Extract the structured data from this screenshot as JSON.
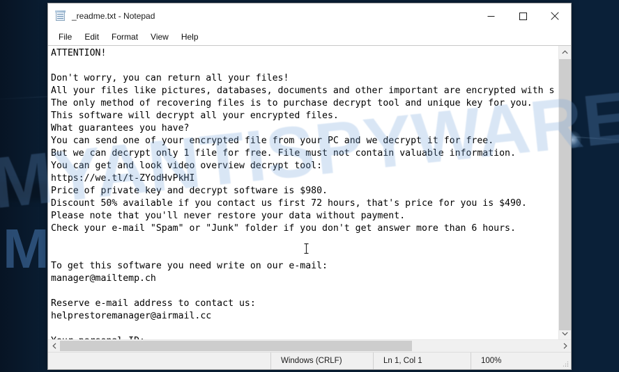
{
  "desktop": {
    "watermark_letter": "M",
    "overlay_watermark": "MYANTISPYWARE.COM",
    "bg_dark": "#0a2038",
    "bg_light": "#0d3b6e"
  },
  "window": {
    "title": "_readme.txt - Notepad",
    "icon": "notepad-icon",
    "controls": {
      "minimize": "minimize-icon",
      "maximize": "maximize-icon",
      "close": "close-icon"
    }
  },
  "menubar": {
    "items": [
      {
        "label": "File"
      },
      {
        "label": "Edit"
      },
      {
        "label": "Format"
      },
      {
        "label": "View"
      },
      {
        "label": "Help"
      }
    ]
  },
  "document": {
    "filename": "_readme.txt",
    "lines": [
      "ATTENTION!",
      "",
      "Don't worry, you can return all your files!",
      "All your files like pictures, databases, documents and other important are encrypted with s",
      "The only method of recovering files is to purchase decrypt tool and unique key for you.",
      "This software will decrypt all your encrypted files.",
      "What guarantees you have?",
      "You can send one of your encrypted file from your PC and we decrypt it for free.",
      "But we can decrypt only 1 file for free. File must not contain valuable information.",
      "You can get and look video overview decrypt tool:",
      "https://we.tl/t-ZYodHvPkHI",
      "Price of private key and decrypt software is $980.",
      "Discount 50% available if you contact us first 72 hours, that's price for you is $490.",
      "Please note that you'll never restore your data without payment.",
      "Check your e-mail \"Spam\" or \"Junk\" folder if you don't get answer more than 6 hours.",
      "",
      "",
      "To get this software you need write on our e-mail:",
      "manager@mailtemp.ch",
      "",
      "Reserve e-mail address to contact us:",
      "helprestoremanager@airmail.cc",
      "",
      "Your personal ID:"
    ],
    "ransom_price_full": "$980",
    "ransom_price_discount": "$490",
    "discount_percent": "50%",
    "discount_window_hours": "72",
    "response_time_hours": "6",
    "download_url": "https://we.tl/t-ZYodHvPkHI",
    "primary_email": "manager@mailtemp.ch",
    "reserve_email": "helprestoremanager@airmail.cc"
  },
  "scrollbars": {
    "vertical": {
      "up_arrow": "chevron-up-icon",
      "down_arrow": "chevron-down-icon"
    },
    "horizontal": {
      "left_arrow": "chevron-left-icon",
      "right_arrow": "chevron-right-icon"
    }
  },
  "statusbar": {
    "line_ending": "Windows (CRLF)",
    "cursor_position": "Ln 1, Col 1",
    "zoom": "100%"
  }
}
